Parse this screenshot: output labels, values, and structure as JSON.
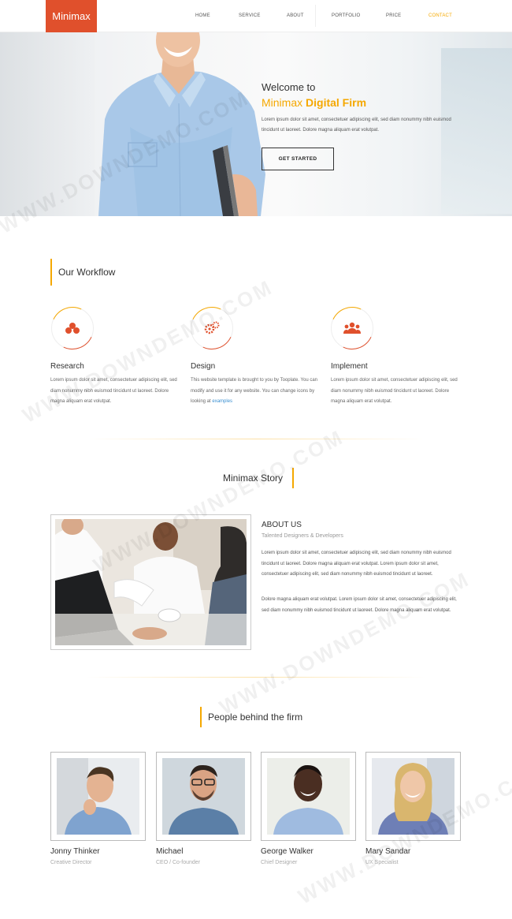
{
  "nav": {
    "logo": "Minimax",
    "items": [
      {
        "label": "HOME"
      },
      {
        "label": "SERVICE"
      },
      {
        "label": "ABOUT"
      },
      {
        "label": "PORTFOLIO"
      },
      {
        "label": "PRICE"
      },
      {
        "label": "CONTACT"
      }
    ]
  },
  "hero": {
    "welcome": "Welcome to",
    "title_a": "Minimax",
    "title_b": "Digital Firm",
    "desc": "Lorem ipsum dolor sit amet, consectetuer adipiscing elit, sed diam nonummy nibh euismod tincidunt ut laoreet. Dolore magna aliquam erat volutpat.",
    "button": "GET STARTED"
  },
  "workflow": {
    "title": "Our Workflow",
    "items": [
      {
        "name": "Research",
        "text": "Lorem ipsum dolor sit amet, consectetuer adipiscing elit, sed diam nonummy nibh euismod tincidunt ut laoreet. Dolore magna aliquam erat volutpat."
      },
      {
        "name": "Design",
        "text": "This website template is brought to you by Tooplate. You can modify and use it for any website. You can change icons by looking at ",
        "link": "examples"
      },
      {
        "name": "Implement",
        "text": "Lorem ipsum dolor sit amet, consectetuer adipiscing elit, sed diam nonummy nibh euismod tincidunt ut laoreet. Dolore magna aliquam erat volutpat."
      }
    ]
  },
  "story": {
    "title": "Minimax Story",
    "about_title": "ABOUT US",
    "about_sub": "Talented Designers & Developers",
    "p1": "Lorem ipsum dolor sit amet, consectetuer adipiscing elit, sed diam nonummy nibh euismod tincidunt ut laoreet. Dolore magna aliquam erat volutpat. Lorem ipsum dolor sit amet, consectetuer adipiscing elit, sed diam nonummy nibh euismod tincidunt ut laoreet.",
    "p2": "Dolore magna aliquam erat volutpat. Lorem ipsum dolor sit amet, consectetuer adipiscing elit, sed diam nonummy nibh euismod tincidunt ut laoreet. Dolore magna aliquam erat volutpat."
  },
  "team": {
    "title": "People behind the firm",
    "members": [
      {
        "name": "Jonny Thinker",
        "role": "Creative Director"
      },
      {
        "name": "Michael",
        "role": "CEO / Co-founder"
      },
      {
        "name": "George Walker",
        "role": "Chief Designer"
      },
      {
        "name": "Mary Sandar",
        "role": "UX Specialist"
      }
    ]
  },
  "watermark": "WWW.DOWNDEMO.COM",
  "colors": {
    "accent": "#f5a800",
    "brand": "#e0502c"
  }
}
